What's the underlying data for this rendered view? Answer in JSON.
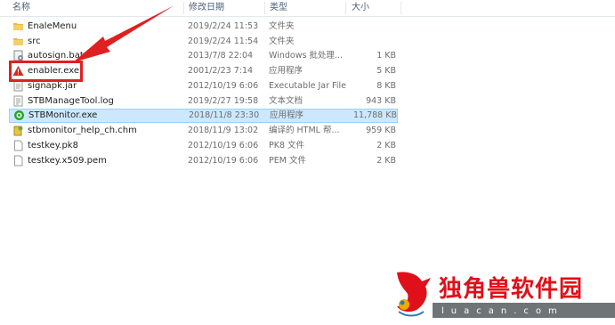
{
  "header": {
    "name": "名称",
    "date": "修改日期",
    "type": "类型",
    "size": "大小"
  },
  "files": [
    {
      "name": "EnaleMenu",
      "date": "2019/2/24 11:53",
      "type": "文件夹",
      "size": "",
      "icon": "folder-icon"
    },
    {
      "name": "src",
      "date": "2019/2/24 11:54",
      "type": "文件夹",
      "size": "",
      "icon": "folder-icon"
    },
    {
      "name": "autosign.bat",
      "date": "2013/7/8 22:04",
      "type": "Windows 批处理...",
      "size": "1 KB",
      "icon": "batch-file-icon"
    },
    {
      "name": "enabler.exe",
      "date": "2001/2/23 7:14",
      "type": "应用程序",
      "size": "5 KB",
      "icon": "warning-app-icon"
    },
    {
      "name": "signapk.jar",
      "date": "2012/10/19 6:06",
      "type": "Executable Jar File",
      "size": "8 KB",
      "icon": "jar-file-icon"
    },
    {
      "name": "STBManageTool.log",
      "date": "2019/2/27 19:58",
      "type": "文本文档",
      "size": "943 KB",
      "icon": "text-file-icon"
    },
    {
      "name": "STBMonitor.exe",
      "date": "2018/11/8 23:30",
      "type": "应用程序",
      "size": "11,788 KB",
      "icon": "app-icon",
      "selected": true
    },
    {
      "name": "stbmonitor_help_ch.chm",
      "date": "2018/11/9 13:02",
      "type": "编译的 HTML 帮...",
      "size": "959 KB",
      "icon": "chm-file-icon"
    },
    {
      "name": "testkey.pk8",
      "date": "2012/10/19 6:06",
      "type": "PK8 文件",
      "size": "2 KB",
      "icon": "file-icon"
    },
    {
      "name": "testkey.x509.pem",
      "date": "2012/10/19 6:06",
      "type": "PEM 文件",
      "size": "2 KB",
      "icon": "file-icon"
    }
  ],
  "watermark": {
    "title": "独角兽软件园",
    "domain": "luacan.com"
  },
  "colors": {
    "highlight": "#e02020",
    "selection": "#cce8ff",
    "watermark_red": "#e0101a"
  }
}
